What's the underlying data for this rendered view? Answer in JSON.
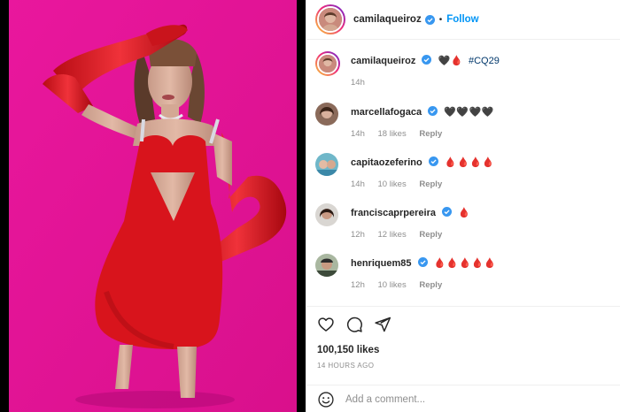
{
  "post": {
    "author": {
      "username": "camilaqueiroz",
      "verified": true
    },
    "follow_label": "Follow",
    "separator": "•",
    "caption": {
      "username": "camilaqueiroz",
      "text": "🖤🩸",
      "hashtag": "#CQ29",
      "time": "14h"
    },
    "comments": [
      {
        "username": "marcellafogaca",
        "verified": true,
        "text": "🖤🖤🖤🖤",
        "time": "14h",
        "likes": "18 likes",
        "reply": "Reply"
      },
      {
        "username": "capitaozeferino",
        "verified": true,
        "text": "🩸🩸🩸🩸",
        "time": "14h",
        "likes": "10 likes",
        "reply": "Reply"
      },
      {
        "username": "franciscaprpereira",
        "verified": true,
        "text": "🩸",
        "time": "12h",
        "likes": "12 likes",
        "reply": "Reply"
      },
      {
        "username": "henriquem85",
        "verified": true,
        "text": "🩸🩸🩸🩸🩸",
        "time": "12h",
        "likes": "10 likes",
        "reply": "Reply"
      }
    ],
    "likes_count": "100,150 likes",
    "posted_ago": "14 HOURS AGO",
    "comment_placeholder": "Add a comment..."
  },
  "icons": {
    "like": "heart-icon",
    "comment": "comment-icon",
    "share": "share-icon",
    "emoji": "emoji-icon",
    "verified": "verified-badge-icon"
  },
  "colors": {
    "background_magenta": "#e6199a",
    "dress_red": "#d8141c",
    "link_blue": "#0095f6",
    "verified_blue": "#3897f0",
    "meta_gray": "#8e8e8e"
  }
}
